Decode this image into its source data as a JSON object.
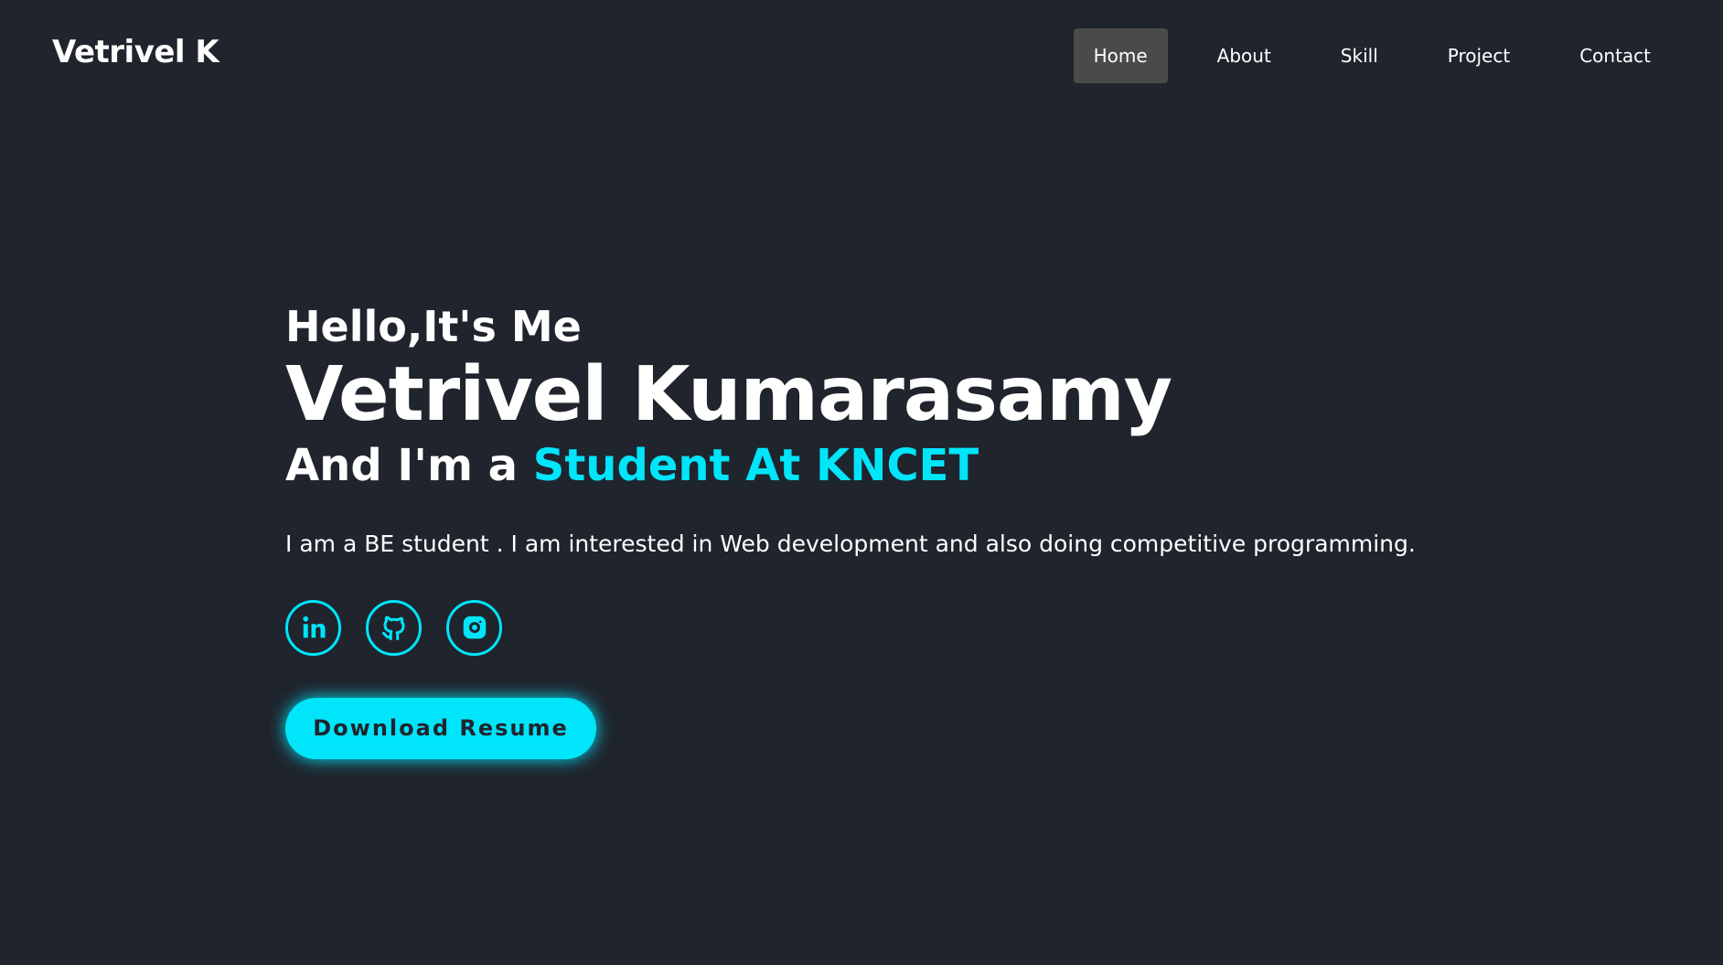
{
  "header": {
    "logo": "Vetrivel K",
    "nav": [
      {
        "label": "Home",
        "active": true
      },
      {
        "label": "About",
        "active": false
      },
      {
        "label": "Skill",
        "active": false
      },
      {
        "label": "Project",
        "active": false
      },
      {
        "label": "Contact",
        "active": false
      }
    ]
  },
  "home": {
    "greeting": "Hello,It's Me",
    "name": "Vetrivel Kumarasamy",
    "role_prefix": "And I'm a ",
    "role_highlight": "Student At KNCET",
    "description": "I am a BE student . I am interested in Web development and also doing competitive programming.",
    "social": [
      {
        "icon": "linkedin-icon"
      },
      {
        "icon": "github-icon"
      },
      {
        "icon": "instagram-icon"
      }
    ],
    "button_label": "Download Resume"
  },
  "colors": {
    "background": "#1f242d",
    "accent": "#00e5f9",
    "nav_active_bg": "#4a4a4a",
    "text": "#ffffff"
  }
}
